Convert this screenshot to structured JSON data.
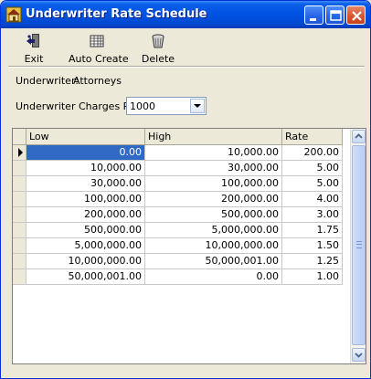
{
  "window": {
    "title": "Underwriter Rate Schedule",
    "controls": [
      "minimize-icon",
      "maximize-icon",
      "close-icon"
    ]
  },
  "toolbar": {
    "exit_label": "Exit",
    "auto_create_label": "Auto Create",
    "delete_label": "Delete",
    "icons": [
      "exit-icon",
      "auto-create-icon",
      "delete-icon"
    ]
  },
  "form": {
    "underwriter_label": "Underwriter:",
    "underwriter_value": "Attorneys",
    "charges_per_label": "Underwriter Charges Per",
    "charges_per_value": "1000"
  },
  "grid": {
    "columns": [
      "Low",
      "High",
      "Rate"
    ],
    "selected_row": 0,
    "rows": [
      [
        "0.00",
        "10,000.00",
        "200.00"
      ],
      [
        "10,000.00",
        "30,000.00",
        "5.00"
      ],
      [
        "30,000.00",
        "100,000.00",
        "5.00"
      ],
      [
        "100,000.00",
        "200,000.00",
        "4.00"
      ],
      [
        "200,000.00",
        "500,000.00",
        "3.00"
      ],
      [
        "500,000.00",
        "5,000,000.00",
        "1.75"
      ],
      [
        "5,000,000.00",
        "10,000,000.00",
        "1.50"
      ],
      [
        "10,000,000.00",
        "50,000,001.00",
        "1.25"
      ],
      [
        "50,000,001.00",
        "0.00",
        "1.00"
      ]
    ]
  },
  "colors": {
    "title_bar": "#0053e2",
    "close_button": "#d9562f",
    "selection": "#316ac5",
    "face": "#ece9d8"
  }
}
